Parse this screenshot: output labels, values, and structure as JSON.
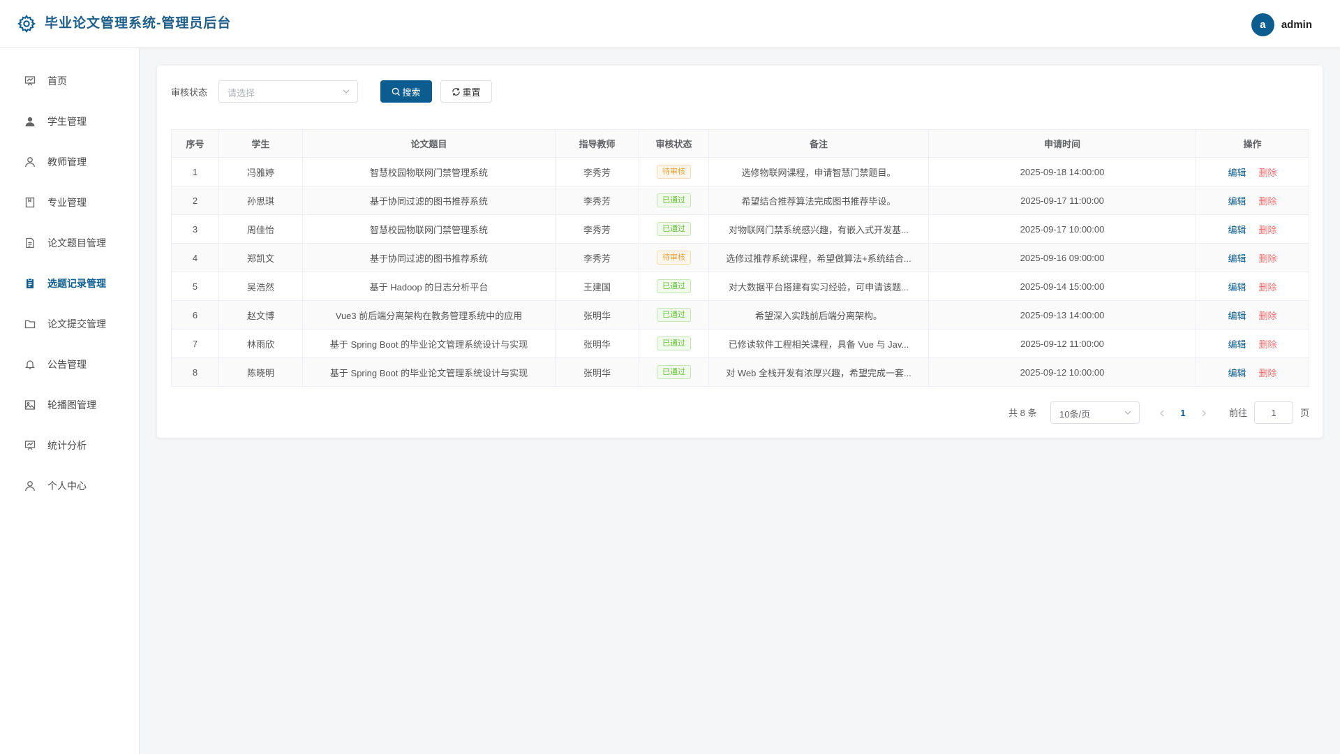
{
  "app": {
    "title": "毕业论文管理系统-管理员后台"
  },
  "user": {
    "avatar_letter": "a",
    "name": "admin"
  },
  "sidebar": {
    "items": [
      {
        "label": "首页",
        "icon": "dashboard-icon"
      },
      {
        "label": "学生管理",
        "icon": "user-filled-icon"
      },
      {
        "label": "教师管理",
        "icon": "user-icon"
      },
      {
        "label": "专业管理",
        "icon": "notebook-icon"
      },
      {
        "label": "论文题目管理",
        "icon": "document-icon"
      },
      {
        "label": "选题记录管理",
        "icon": "tickets-icon",
        "active": true
      },
      {
        "label": "论文提交管理",
        "icon": "folder-icon"
      },
      {
        "label": "公告管理",
        "icon": "bell-icon"
      },
      {
        "label": "轮播图管理",
        "icon": "picture-icon"
      },
      {
        "label": "统计分析",
        "icon": "chart-icon"
      },
      {
        "label": "个人中心",
        "icon": "user-icon"
      }
    ]
  },
  "filter": {
    "label": "审核状态",
    "select_placeholder": "请选择",
    "search_label": "搜索",
    "reset_label": "重置"
  },
  "table": {
    "headers": [
      "序号",
      "学生",
      "论文题目",
      "指导教师",
      "审核状态",
      "备注",
      "申请时间",
      "操作"
    ],
    "edit_label": "编辑",
    "delete_label": "删除",
    "rows": [
      {
        "no": "1",
        "student": "冯雅婷",
        "title": "智慧校园物联网门禁管理系统",
        "teacher": "李秀芳",
        "status": "待审核",
        "status_type": "pending",
        "remark": "选修物联网课程，申请智慧门禁题目。",
        "time": "2025-09-18 14:00:00"
      },
      {
        "no": "2",
        "student": "孙思琪",
        "title": "基于协同过滤的图书推荐系统",
        "teacher": "李秀芳",
        "status": "已通过",
        "status_type": "passed",
        "remark": "希望结合推荐算法完成图书推荐毕设。",
        "time": "2025-09-17 11:00:00"
      },
      {
        "no": "3",
        "student": "周佳怡",
        "title": "智慧校园物联网门禁管理系统",
        "teacher": "李秀芳",
        "status": "已通过",
        "status_type": "passed",
        "remark": "对物联网门禁系统感兴趣，有嵌入式开发基...",
        "time": "2025-09-17 10:00:00"
      },
      {
        "no": "4",
        "student": "郑凯文",
        "title": "基于协同过滤的图书推荐系统",
        "teacher": "李秀芳",
        "status": "待审核",
        "status_type": "pending",
        "remark": "选修过推荐系统课程，希望做算法+系统结合...",
        "time": "2025-09-16 09:00:00"
      },
      {
        "no": "5",
        "student": "吴浩然",
        "title": "基于 Hadoop 的日志分析平台",
        "teacher": "王建国",
        "status": "已通过",
        "status_type": "passed",
        "remark": "对大数据平台搭建有实习经验，可申请该题...",
        "time": "2025-09-14 15:00:00"
      },
      {
        "no": "6",
        "student": "赵文博",
        "title": "Vue3 前后端分离架构在教务管理系统中的应用",
        "teacher": "张明华",
        "status": "已通过",
        "status_type": "passed",
        "remark": "希望深入实践前后端分离架构。",
        "time": "2025-09-13 14:00:00"
      },
      {
        "no": "7",
        "student": "林雨欣",
        "title": "基于 Spring Boot 的毕业论文管理系统设计与实现",
        "teacher": "张明华",
        "status": "已通过",
        "status_type": "passed",
        "remark": "已修读软件工程相关课程，具备 Vue 与 Jav...",
        "time": "2025-09-12 11:00:00"
      },
      {
        "no": "8",
        "student": "陈晓明",
        "title": "基于 Spring Boot 的毕业论文管理系统设计与实现",
        "teacher": "张明华",
        "status": "已通过",
        "status_type": "passed",
        "remark": "对 Web 全栈开发有浓厚兴趣，希望完成一套...",
        "time": "2025-09-12 10:00:00"
      }
    ]
  },
  "pagination": {
    "total_text": "共 8 条",
    "page_size": "10条/页",
    "current_page": "1",
    "goto_label": "前往",
    "goto_value": "1",
    "page_unit": "页"
  },
  "colors": {
    "primary": "#0b5c8f",
    "danger": "#f56c6c",
    "pending": "#e6a23c",
    "passed": "#67c23a"
  }
}
